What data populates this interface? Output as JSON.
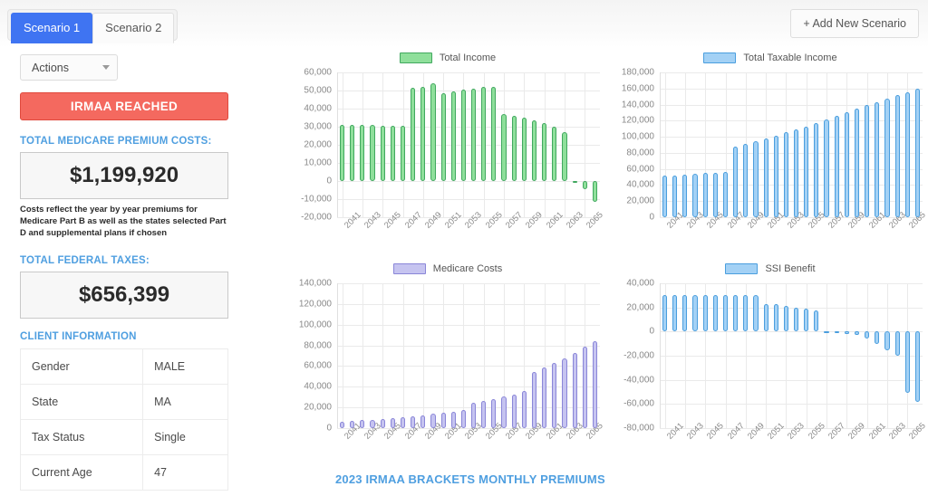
{
  "header": {
    "tabs": [
      {
        "label": "Scenario 1",
        "active": true
      },
      {
        "label": "Scenario 2",
        "active": false
      }
    ],
    "add_scenario_label": "+ Add New Scenario"
  },
  "sidebar": {
    "actions_label": "Actions",
    "irmaa_banner": "IRMAA REACHED",
    "medicare_label": "TOTAL MEDICARE PREMIUM COSTS:",
    "medicare_value": "$1,199,920",
    "medicare_note": "Costs reflect the year by year premiums for Medicare Part B as well as the states selected Part D and supplemental plans if chosen",
    "taxes_label": "TOTAL FEDERAL TAXES:",
    "taxes_value": "$656,399",
    "client_info_label": "CLIENT INFORMATION",
    "client_info_rows": [
      {
        "key": "Gender",
        "value": "MALE"
      },
      {
        "key": "State",
        "value": "MA"
      },
      {
        "key": "Tax Status",
        "value": "Single"
      },
      {
        "key": "Current Age",
        "value": "47"
      }
    ]
  },
  "main": {
    "footer_title": "2023 IRMAA BRACKETS MONTHLY PREMIUMS"
  },
  "colors": {
    "accent_blue": "#4f9fe0",
    "tab_active": "#3f74f2",
    "danger": "#f4695f",
    "green_fill": "#8fdf9b",
    "green_stroke": "#41a85f",
    "blue_fill": "#a3d1f5",
    "blue_stroke": "#4a9ede",
    "purple_fill": "#c6c4f0",
    "purple_stroke": "#8a86d8"
  },
  "chart_data": [
    {
      "id": "total-income",
      "type": "bar",
      "title": "Total Income",
      "legend": "Total Income",
      "legend_position": "top",
      "grid": true,
      "xlabel": "",
      "ylabel": "",
      "ylim": [
        -20000,
        60000
      ],
      "yticks": [
        60000,
        50000,
        40000,
        30000,
        20000,
        10000,
        0,
        -10000,
        -20000
      ],
      "ytick_labels": [
        "60,000",
        "50,000",
        "40,000",
        "30,000",
        "20,000",
        "10,000",
        "0",
        "-10,000",
        "-20,000"
      ],
      "tick_years": [
        "2041",
        "2043",
        "2045",
        "2047",
        "2049",
        "2051",
        "2053",
        "2055",
        "2057",
        "2059",
        "2061",
        "2063",
        "2065"
      ],
      "x": [
        2041,
        2042,
        2043,
        2044,
        2045,
        2046,
        2047,
        2048,
        2049,
        2050,
        2051,
        2052,
        2053,
        2054,
        2055,
        2056,
        2057,
        2058,
        2059,
        2060,
        2061,
        2062,
        2063,
        2064,
        2065,
        2066
      ],
      "values": [
        31000,
        30900,
        30800,
        30800,
        30700,
        30500,
        30400,
        51300,
        52200,
        53800,
        48500,
        49600,
        50300,
        51000,
        51800,
        52200,
        36800,
        36200,
        35000,
        33600,
        32000,
        29900,
        27200,
        -300,
        -4300,
        -11500
      ]
    },
    {
      "id": "total-taxable-income",
      "type": "bar",
      "title": "Total Taxable Income",
      "legend": "Total Taxable Income",
      "legend_position": "top",
      "grid": true,
      "xlabel": "",
      "ylabel": "",
      "ylim": [
        0,
        180000
      ],
      "yticks": [
        180000,
        160000,
        140000,
        120000,
        100000,
        80000,
        60000,
        40000,
        20000,
        0
      ],
      "ytick_labels": [
        "180,000",
        "160,000",
        "140,000",
        "120,000",
        "100,000",
        "80,000",
        "60,000",
        "40,000",
        "20,000",
        "0"
      ],
      "tick_years": [
        "2041",
        "2043",
        "2045",
        "2047",
        "2049",
        "2051",
        "2053",
        "2055",
        "2057",
        "2059",
        "2061",
        "2063",
        "2065"
      ],
      "x": [
        2041,
        2042,
        2043,
        2044,
        2045,
        2046,
        2047,
        2048,
        2049,
        2050,
        2051,
        2052,
        2053,
        2054,
        2055,
        2056,
        2057,
        2058,
        2059,
        2060,
        2061,
        2062,
        2063,
        2064,
        2065,
        2066
      ],
      "values": [
        51500,
        52000,
        52800,
        53500,
        54600,
        55600,
        56800,
        87500,
        90800,
        94500,
        98200,
        101800,
        105200,
        108800,
        112800,
        117200,
        121300,
        125800,
        130200,
        134800,
        139200,
        143400,
        147000,
        151500,
        155800,
        159500
      ]
    },
    {
      "id": "medicare-costs",
      "type": "bar",
      "title": "Medicare Costs",
      "legend": "Medicare Costs",
      "legend_position": "top",
      "grid": true,
      "xlabel": "",
      "ylabel": "",
      "ylim": [
        0,
        140000
      ],
      "yticks": [
        140000,
        120000,
        100000,
        80000,
        60000,
        40000,
        20000,
        0
      ],
      "ytick_labels": [
        "140,000",
        "120,000",
        "100,000",
        "80,000",
        "60,000",
        "40,000",
        "20,000",
        "0"
      ],
      "tick_years": [
        "2041",
        "2043",
        "2045",
        "2047",
        "2049",
        "2051",
        "2053",
        "2055",
        "2057",
        "2059",
        "2061",
        "2063",
        "2065"
      ],
      "x": [
        2041,
        2042,
        2043,
        2044,
        2045,
        2046,
        2047,
        2048,
        2049,
        2050,
        2051,
        2052,
        2053,
        2054,
        2055,
        2056,
        2057,
        2058,
        2059,
        2060,
        2061,
        2062,
        2063,
        2064,
        2065,
        2066
      ],
      "values": [
        6500,
        7000,
        7600,
        8300,
        9000,
        9800,
        10600,
        11500,
        12500,
        13600,
        14800,
        16100,
        17500,
        24800,
        26400,
        28300,
        30400,
        32800,
        36000,
        54300,
        58500,
        63000,
        67600,
        72800,
        78400,
        84000
      ]
    },
    {
      "id": "ssi-benefit",
      "type": "bar",
      "title": "SSI Benefit",
      "legend": "SSI Benefit",
      "legend_position": "top",
      "grid": true,
      "xlabel": "",
      "ylabel": "",
      "ylim": [
        -80000,
        40000
      ],
      "yticks": [
        40000,
        20000,
        0,
        -20000,
        -40000,
        -60000,
        -80000
      ],
      "ytick_labels": [
        "40,000",
        "20,000",
        "0",
        "-20,000",
        "-40,000",
        "-60,000",
        "-80,000"
      ],
      "tick_years": [
        "2041",
        "2043",
        "2045",
        "2047",
        "2049",
        "2051",
        "2053",
        "2055",
        "2057",
        "2059",
        "2061",
        "2063",
        "2065"
      ],
      "x": [
        2041,
        2042,
        2043,
        2044,
        2045,
        2046,
        2047,
        2048,
        2049,
        2050,
        2051,
        2052,
        2053,
        2054,
        2055,
        2056,
        2057,
        2058,
        2059,
        2060,
        2061,
        2062,
        2063,
        2064,
        2065,
        2066
      ],
      "values": [
        30000,
        30000,
        30000,
        30000,
        30000,
        30000,
        30000,
        30000,
        30000,
        30000,
        23000,
        22500,
        21500,
        20000,
        18700,
        17500,
        600,
        -900,
        -1800,
        -3000,
        -5600,
        -10500,
        -15600,
        -20000,
        -50500,
        -58000
      ]
    }
  ]
}
